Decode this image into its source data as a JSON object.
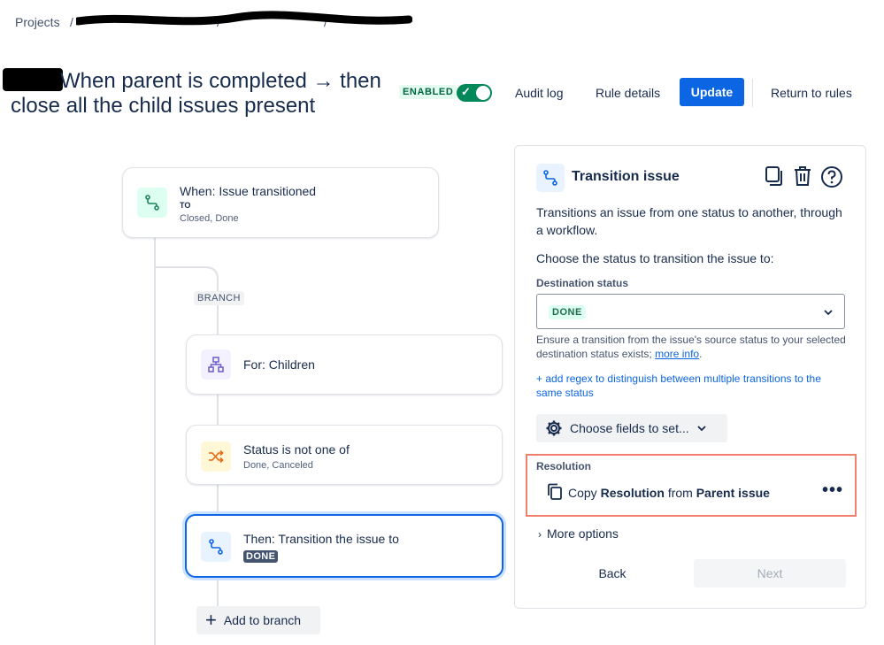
{
  "breadcrumb": {
    "projects": "Projects",
    "sep1": "/",
    "sep2": "/",
    "sep3": "/"
  },
  "header": {
    "title": "When parent is completed → then close all the child issues present",
    "enabled_label": "ENABLED",
    "enabled": true,
    "audit_log": "Audit log",
    "rule_details": "Rule details",
    "update": "Update",
    "return_to_rules": "Return to rules"
  },
  "flow": {
    "trigger": {
      "title": "When: Issue transitioned",
      "to_label": "TO",
      "statuses": "Closed, Done"
    },
    "branch_tag": "BRANCH",
    "for_children": {
      "title": "For: Children"
    },
    "condition": {
      "title": "Status is not one of",
      "subtitle": "Done, Canceled"
    },
    "action": {
      "title": "Then: Transition the issue to",
      "status": "DONE"
    },
    "add_to_branch": "Add to branch"
  },
  "panel": {
    "title": "Transition issue",
    "description": "Transitions an issue from one status to another, through a workflow.",
    "choose_status": "Choose the status to transition the issue to:",
    "dest_label": "Destination status",
    "dest_value": "DONE",
    "helper_text": "Ensure a transition from the issue's source status to your selected destination status exists;",
    "more_info": "more info",
    "period": ".",
    "regex_link": "+ add regex to distinguish between multiple transitions to the same status",
    "choose_fields": "Choose fields to set...",
    "resolution_label": "Resolution",
    "copy_prefix": "Copy",
    "copy_field": "Resolution",
    "copy_from": "from",
    "copy_source": "Parent issue",
    "more_options": "More options",
    "back": "Back",
    "next": "Next"
  },
  "colors": {
    "primary": "#0c66e4",
    "toggle_on": "#00875a",
    "highlight_border": "#f07f6e"
  }
}
